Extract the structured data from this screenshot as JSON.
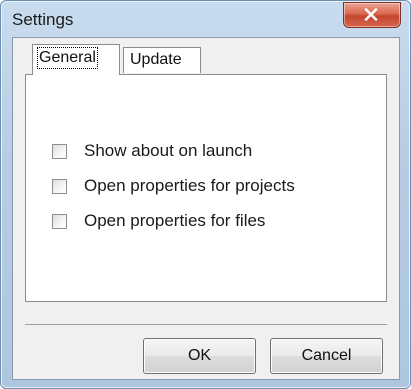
{
  "window": {
    "title": "Settings",
    "close_icon": "close-icon"
  },
  "tabs": [
    {
      "label": "General",
      "selected": true
    },
    {
      "label": "Update",
      "selected": false
    }
  ],
  "options": [
    {
      "label": "Show about on launch",
      "checked": false
    },
    {
      "label": "Open properties for projects",
      "checked": false
    },
    {
      "label": "Open properties for files",
      "checked": false
    }
  ],
  "buttons": {
    "ok_label": "OK",
    "cancel_label": "Cancel"
  },
  "colors": {
    "title_bar": "#b7cde4",
    "close_button": "#c3462d",
    "panel_background": "#ffffff",
    "dialog_background": "#f0f0f0"
  }
}
